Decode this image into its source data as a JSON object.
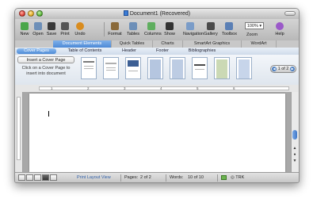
{
  "window": {
    "title": "Document1 (Recovered)"
  },
  "toolbar": {
    "buttons": [
      {
        "label": "New",
        "icon": "new-document-icon",
        "color": "#4aa64a"
      },
      {
        "label": "Open",
        "icon": "open-folder-icon",
        "color": "#6d8fb8"
      },
      {
        "label": "Save",
        "icon": "save-disk-icon",
        "color": "#3a3a3a"
      },
      {
        "label": "Print",
        "icon": "printer-icon",
        "color": "#555555"
      },
      {
        "label": "Undo",
        "icon": "undo-icon",
        "color": "#d98c1e"
      },
      {
        "label": "Format",
        "icon": "format-brush-icon",
        "color": "#8a6a3a"
      },
      {
        "label": "Tables",
        "icon": "table-grid-icon",
        "color": "#6d8fb8"
      },
      {
        "label": "Columns",
        "icon": "columns-icon",
        "color": "#5fae5f"
      },
      {
        "label": "Show",
        "icon": "pilcrow-icon",
        "color": "#333333"
      },
      {
        "label": "Navigation",
        "icon": "navigation-pane-icon",
        "color": "#7a9cc8"
      },
      {
        "label": "Gallery",
        "icon": "gallery-icon",
        "color": "#4a4a4a"
      },
      {
        "label": "Toolbox",
        "icon": "toolbox-icon",
        "color": "#5a7fb5"
      }
    ],
    "zoom_value": "100%",
    "zoom_label": "Zoom",
    "help_label": "Help",
    "help_color": "#9b59c9"
  },
  "ribbon": {
    "tabs": [
      "Document Elements",
      "Quick Tables",
      "Charts",
      "SmartArt Graphics",
      "WordArt"
    ],
    "active_tab": 0,
    "subtabs": [
      "Cover Pages",
      "Table of Contents",
      "Header",
      "Footer",
      "Bibliographies"
    ],
    "active_subtab": 0
  },
  "gallery": {
    "insert_button": "Insert a Cover Page",
    "hint": "Click on a Cover Page to insert into document",
    "page_indicator": "1 of 2",
    "thumb_colors": [
      "#7a7a7a",
      "#b0b0b0",
      "#3c5f94",
      "#6c8ec2",
      "#5a7fb8",
      "#4a4a4a",
      "#8cab5c",
      "#5e86c4"
    ]
  },
  "ruler": {
    "numbers": [
      "1",
      "2",
      "3",
      "4",
      "5",
      "6"
    ]
  },
  "status": {
    "view_label": "Print Layout View",
    "pages_label": "Pages:",
    "pages_value": "2 of 2",
    "words_label": "Words:",
    "words_value": "10 of 10",
    "track_label": "TRK"
  }
}
